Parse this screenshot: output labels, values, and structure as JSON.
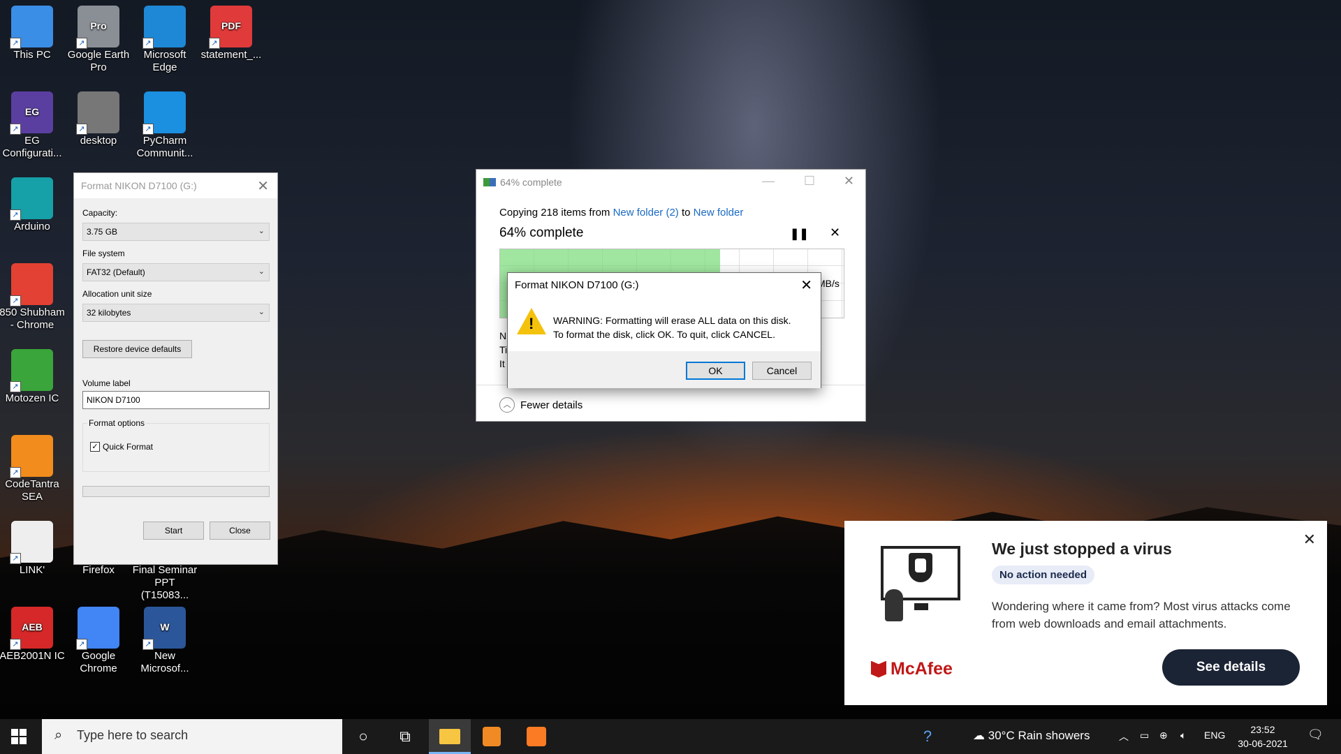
{
  "desktop": {
    "icons": [
      {
        "label": "This PC",
        "icon": "computer-icon",
        "color": "#3a8ee6"
      },
      {
        "label": "Google Earth Pro",
        "icon": "google-earth-icon",
        "color": "#8a8f96",
        "badge": "Pro"
      },
      {
        "label": "Microsoft Edge",
        "icon": "edge-icon",
        "color": "#1e88d6"
      },
      {
        "label": "statement_...",
        "icon": "pdf-icon",
        "color": "#e03a3a",
        "badge": "PDF"
      },
      {
        "label": "EG Configurati...",
        "icon": "eg-config-icon",
        "color": "#5b3fa0",
        "badge": "EG"
      },
      {
        "label": "desktop",
        "icon": "settings-file-icon",
        "color": "#777777"
      },
      {
        "label": "PyCharm Communit...",
        "icon": "pycharm-icon",
        "color": "#1b8fe0"
      },
      {
        "label": "Arduino",
        "icon": "arduino-icon",
        "color": "#16a0a8"
      },
      {
        "label": "850 Shubham - Chrome",
        "icon": "chrome-profile-icon",
        "color": "#e34133"
      },
      {
        "label": "Motozen IC",
        "icon": "motozen-icon",
        "color": "#3aa53a"
      },
      {
        "label": "CodeTantra SEA",
        "icon": "codetantra-icon",
        "color": "#f28c1c"
      },
      {
        "label": "LINK'",
        "icon": "blank-file-icon",
        "color": "#eeeeee"
      },
      {
        "label": "Firefox",
        "icon": "firefox-icon",
        "color": "#e66000"
      },
      {
        "label": "Final Seminar PPT (T15083...",
        "icon": "ppt-file-icon",
        "color": "#c43e1c"
      },
      {
        "label": "AEB2001N IC",
        "icon": "aeb-icon",
        "color": "#d62828",
        "badge": "AEB"
      },
      {
        "label": "Google Chrome",
        "icon": "chrome-icon",
        "color": "#4285f4"
      },
      {
        "label": "New Microsof...",
        "icon": "word-icon",
        "color": "#2b579a",
        "badge": "W"
      }
    ]
  },
  "format_dialog": {
    "title": "Format NIKON D7100 (G:)",
    "capacity_label": "Capacity:",
    "capacity_value": "3.75 GB",
    "filesystem_label": "File system",
    "filesystem_value": "FAT32 (Default)",
    "allocation_label": "Allocation unit size",
    "allocation_value": "32 kilobytes",
    "restore_button": "Restore device defaults",
    "volume_label": "Volume label",
    "volume_value": "NIKON D7100",
    "format_options": "Format options",
    "quick_format": "Quick Format",
    "quick_format_checked": true,
    "start_button": "Start",
    "close_button": "Close"
  },
  "copy_dialog": {
    "title": "64% complete",
    "copying_prefix": "Copying 218 items from ",
    "source": "New folder (2)",
    "to_word": " to ",
    "destination": "New folder",
    "percent_text": "64% complete",
    "progress_fraction": 0.64,
    "speed_partial": "MB/s",
    "left_fragments": [
      "N",
      "Ti",
      "It"
    ],
    "fewer_details": "Fewer details"
  },
  "warning_box": {
    "title": "Format NIKON D7100 (G:)",
    "line1": "WARNING: Formatting will erase ALL data on this disk.",
    "line2": "To format the disk, click OK. To quit, click CANCEL.",
    "ok": "OK",
    "cancel": "Cancel"
  },
  "mcafee": {
    "headline": "We just stopped a virus",
    "pill": "No action needed",
    "body": "Wondering where it came from? Most virus attacks come from web downloads and email attachments.",
    "brand": "McAfee",
    "button": "See details"
  },
  "taskbar": {
    "search_placeholder": "Type here to search",
    "weather_temp": "30°C",
    "weather_desc": "Rain showers",
    "language": "ENG",
    "time": "23:52",
    "date": "30-06-2021"
  }
}
